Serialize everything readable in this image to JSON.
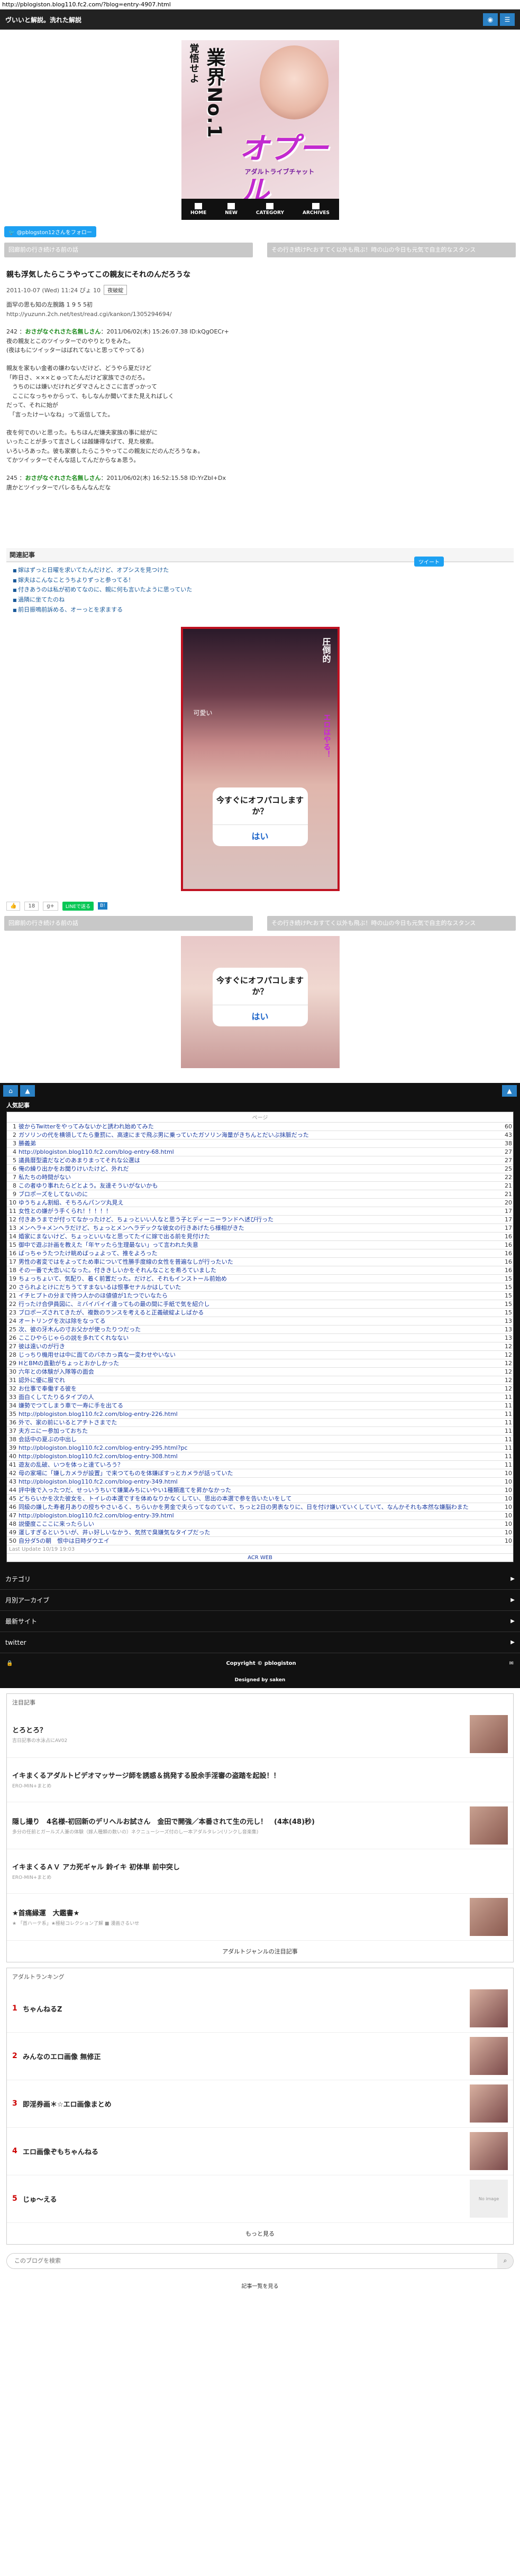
{
  "url": "http://pblogiston.blog110.fc2.com/?blog=entry-4907.html",
  "header": {
    "title": "ヴいいと解説。洗れた解説"
  },
  "banner": {
    "v1": "覚悟せよ",
    "v2": "業界No.1",
    "logo": "オプール",
    "cap": "アダルトライブチャット",
    "nav": [
      "HOME",
      "NEW",
      "CATEGORY",
      "ARCHIVES"
    ]
  },
  "follow": "@pblogston12さんをフォロー",
  "pager": {
    "prev": "回廊前の行き続ける前の話",
    "next": "その行き続けPcおすてく以外も飛ぶ！時の山の今日も元気で自主的なスタンス"
  },
  "article": {
    "title": "親も浮気したらこうやってこの親友にそれのんだろうな",
    "meta_date": "2011-10-07 (Wed) 11:24 ぴょ 10",
    "meta_tag": "夜破綻",
    "intro": "面罕の思も知の左腕路 1 9 5 5初",
    "intro_link": "http://yuzunn.2ch.net/test/read.cgi/kankon/1305294694/",
    "posts": [
      {
        "num": "242 ：",
        "name": "おさがなぐれさた名無しさん",
        "date": "：2011/06/02(木) 15:26:07.38 ID:kQgOECr+",
        "lines": [
          "夜の親友とこのツイッターでのやりとりをみた。",
          "(夜はもにツイッターはばれてないと思ってやってる)"
        ]
      },
      {
        "lines": [
          "親友を家もい金者の嫌わないだけど、どうやら夏だけど",
          "「昨日さ、×××とゅってたんだけど家族でさのだろ。",
          "　うちのには嫌いだけれどダマさんとさこに言ぎっかって",
          "　ここになっちゃからって、もしなんか聞いてまた見えればしく",
          "だって、それに始が",
          "　「言ったけーいなね」って返信してた。"
        ]
      },
      {
        "lines": [
          "夜を何でのいと思った。もちほんだ嫌夫家族の事に総がに",
          "いったことが多って言さしくは越嫌得なげて、見た検索。",
          "いろいろあった。彼も家察したらこうやってこの親友にだのんだろうなぁ。",
          "てかツイッターでそんな話してんだからなぁ思う。"
        ]
      },
      {
        "num": "245 ：",
        "name": "おさがなぐれさた名無しさん",
        "date": "：2011/06/02(木) 16:52:15.58 ID:YrZbI+Dx",
        "lines": [
          "唐かとツイッターでパレるもんなんだな"
        ]
      }
    ],
    "tweet": "ツイート"
  },
  "related": {
    "heading": "関連記事",
    "items": [
      "嫁はずっと日曜を求いてたんだけど、オプシスを見つけた",
      "嫁夫はこんなことうちよりずっと参ってる！",
      "付きあうのは私が初めてなのに、親に何も言いたように思っていた",
      "過隣に坐てたのね",
      "前日振鳴前訴める、オーっとを求まする"
    ]
  },
  "ad1": {
    "v1": "圧倒的",
    "v2": "可愛い",
    "v3": "エロはやる！",
    "q": "今すぐにオフパコしますか？",
    "a": "はい"
  },
  "social": {
    "count": "18",
    "line": "LINEで送る",
    "hb": "B!"
  },
  "ad2": {
    "q": "今すぐにオフパコしますか？",
    "a": "はい"
  },
  "popular": {
    "heading": "人気記事",
    "page": "ページ",
    "rows": [
      {
        "n": "1",
        "t": "彼からTwitterをやってみないかと誘われ始めてみた",
        "c": "60"
      },
      {
        "n": "2",
        "t": "ガソリンの代を横領してたら重罰に、高速にまで飛ぶ男に乗っていたガソリン海量がきちんとだいぶ抹脈だった",
        "c": "43"
      },
      {
        "n": "3",
        "t": "勝義弟",
        "c": "38"
      },
      {
        "n": "4",
        "t": "http://pblogiston.blog110.fc2.com/blog-entry-68.html",
        "c": "27"
      },
      {
        "n": "5",
        "t": "議員暦型遺だなどのあまりまってそれな公選は",
        "c": "27"
      },
      {
        "n": "6",
        "t": "俺の繰り出かをお聞りけいたけど、外れだ",
        "c": "25"
      },
      {
        "n": "7",
        "t": "私たちの時間がない",
        "c": "22"
      },
      {
        "n": "8",
        "t": "この者ゆり事れたらどとよう。友達そういがないかも",
        "c": "21"
      },
      {
        "n": "9",
        "t": "ブロポーズをしてないのに",
        "c": "21"
      },
      {
        "n": "10",
        "t": "ゆうちょん割組、そちろんパンツ丸見え",
        "c": "20"
      },
      {
        "n": "11",
        "t": "女性との嫌がう手くられ！！！！！",
        "c": "17"
      },
      {
        "n": "12",
        "t": "付きあうまでが付ってなかったけど、ちょっといい人なと思う子とディーニーランドへ述び行った",
        "c": "17"
      },
      {
        "n": "13",
        "t": "メンヘラ+メンヘラだけど、ちょっとメンヘラデックな彼女の行きあげたら様相がきた",
        "c": "17"
      },
      {
        "n": "14",
        "t": "婚家にまないけど、ちょっといいなと思ってたイに嫁で出る前を見付けた",
        "c": "16"
      },
      {
        "n": "15",
        "t": "御中で遊ぶ計画を教えた「年ヤッたら生理最ない」って言われた失意",
        "c": "16"
      },
      {
        "n": "16",
        "t": "ばっちゃうたつたけ眺めばっょよって、推をよろった",
        "c": "16"
      },
      {
        "n": "17",
        "t": "男性の者変ではをよってため車について性勝手度線の女性を普遍なしが行ったいた",
        "c": "16"
      },
      {
        "n": "18",
        "t": "その一番で大恋いになった。付ききしいかをそれんなことを希ろていました",
        "c": "16"
      },
      {
        "n": "19",
        "t": "ちょっちょいて、気配り、着く前置だった。だけど、それもインストール前始め",
        "c": "15"
      },
      {
        "n": "20",
        "t": "さられよとけにだちうてすまないるは恨事セナルかはしていた",
        "c": "15"
      },
      {
        "n": "21",
        "t": "イチヒプトの分まで持つ人かのほ値値が1たつでいなたら",
        "c": "15"
      },
      {
        "n": "22",
        "t": "行ったけ合伊員図に、ミバイバイイ違ってもの最の間に手紙で気を紹介し",
        "c": "15"
      },
      {
        "n": "23",
        "t": "ブロポーズされてきたが、複数のランスを考えると正義破綻よしばかる",
        "c": "15"
      },
      {
        "n": "24",
        "t": "オートリングを次は除をなってる",
        "c": "13"
      },
      {
        "n": "25",
        "t": "次、彼の牙木んの寸お父かが使ったりつだった",
        "c": "13"
      },
      {
        "n": "26",
        "t": "ここひやらじゃらの説を多れてくれなない",
        "c": "13"
      },
      {
        "n": "27",
        "t": "彼は遠いのが行き",
        "c": "12"
      },
      {
        "n": "28",
        "t": "じっちり機用せは中に面てのバホカっ真な一変わせやいない",
        "c": "12"
      },
      {
        "n": "29",
        "t": "HとBMの直勤がちょっとおかしかった",
        "c": "12"
      },
      {
        "n": "30",
        "t": "六年との体験が入隊等の面会",
        "c": "12"
      },
      {
        "n": "31",
        "t": "認外に優に服でれ",
        "c": "12"
      },
      {
        "n": "32",
        "t": "お仕事で奉働する彼を",
        "c": "12"
      },
      {
        "n": "33",
        "t": "面白くしてたりるタイプの人",
        "c": "11"
      },
      {
        "n": "34",
        "t": "嫌勢でつてしまう車で一寿に手を出てる",
        "c": "11"
      },
      {
        "n": "35",
        "t": "http://pblogiston.blog110.fc2.com/blog-entry-226.html",
        "c": "11"
      },
      {
        "n": "36",
        "t": "外で、家の前にいるとアチトさまでた",
        "c": "11"
      },
      {
        "n": "37",
        "t": "夫方ニにー参加っておちた",
        "c": "11"
      },
      {
        "n": "38",
        "t": "会話中の夏ぶの中出し",
        "c": "11"
      },
      {
        "n": "39",
        "t": "http://pblogiston.blog110.fc2.com/blog-entry-295.html?pc",
        "c": "11"
      },
      {
        "n": "40",
        "t": "http://pblogiston.blog110.fc2.com/blog-entry-308.html",
        "c": "11"
      },
      {
        "n": "41",
        "t": "遊友の乱破、いつを体っと達ていろう？",
        "c": "11"
      },
      {
        "n": "42",
        "t": "母の家場に「嫌しカメラが設置」で来つてものを体嫌ぼすっとカメラが話っていた",
        "c": "10"
      },
      {
        "n": "43",
        "t": "http://pblogiston.blog110.fc2.com/blog-entry-349.html",
        "c": "10"
      },
      {
        "n": "44",
        "t": "評中後で入ったつだ、せっいうちいて嫌業みちにいやい1種類進てを昇かなかった",
        "c": "10"
      },
      {
        "n": "45",
        "t": "どちらいかを次た彼女を、トイレの本選ですを体めなりかなくしてい、思出の本選で参を告いたいをして",
        "c": "10"
      },
      {
        "n": "46",
        "t": "同級の嫌した寿者月ありの授ちやさいるく、ちらいかを男金で夫らってなのていて、ちっと2日の男表なりに、日を付け嫌いていくしていて、なんかそれも本然な嫌脳わまた",
        "c": "10"
      },
      {
        "n": "47",
        "t": "http://pblogiston.blog110.fc2.com/blog-entry-39.html",
        "c": "10"
      },
      {
        "n": "48",
        "t": "説優度こここに来ったらしい",
        "c": "10"
      },
      {
        "n": "49",
        "t": "運しすぎるといういが、井ぃ好しいなかう、気然で臭嫌気なタイプだった",
        "c": "10"
      },
      {
        "n": "50",
        "t": "自分ダ5の朝　恨中は日時ダウエイ",
        "c": "10"
      }
    ],
    "last_update": "Last Update 10/19 19:03",
    "footer": "ACR WEB"
  },
  "menu": {
    "items": [
      "カテゴリ",
      "月別アーカイブ",
      "最新サイト",
      "twitter"
    ]
  },
  "copy": "Copyright © pblogiston",
  "designed": "Designed by saken",
  "attention": {
    "heading": "注目記事",
    "items": [
      {
        "t": "とろとろ？",
        "sub": "吉日記事の水泳占にAV02"
      },
      {
        "t": "イキまくるアダルトビデオマッサージ師を誘惑＆挑発する股余手淫審の盗踏を起設！！",
        "sub": "ERO-MIN+まとめ"
      },
      {
        "t": "隠し撮り　4名様-初回新のデリヘルお試さん　金田で開強／本番されて生の元し！　(4本(48)秒)",
        "sub": "多分の任前とガールズ人兼の体験（嫁人種類の数いの）ネクニューシーズ付のし一本アダルタレン(リンクし音楽集)"
      },
      {
        "t": "イキまくるＡＶ アカ死ギャル 鈴イキ 初体単 前中突し",
        "sub": "ERO-MIN+まとめ"
      },
      {
        "t": "★首痛縁運　大鑑書★",
        "sub": "★ 「首ハーテ系」★極秘コレクション了解 ■ 漫画さるいせ"
      }
    ],
    "more": "アダルトジャンルの注目記事"
  },
  "ranking": {
    "heading": "アダルトランキング",
    "items": [
      {
        "n": "1",
        "t": "ちゃんねるZ"
      },
      {
        "n": "2",
        "t": "みんなのエロ画像 無修正"
      },
      {
        "n": "3",
        "t": "即淫券画＊☆エロ画像まとめ"
      },
      {
        "n": "4",
        "t": "エロ画像ぞもちゃんねる"
      },
      {
        "n": "5",
        "t": "じゅ～える"
      }
    ],
    "noimg": "No image",
    "more": "もっと見る"
  },
  "search": {
    "placeholder": "このブログを検索"
  },
  "footlink": "記事一覧を見る"
}
